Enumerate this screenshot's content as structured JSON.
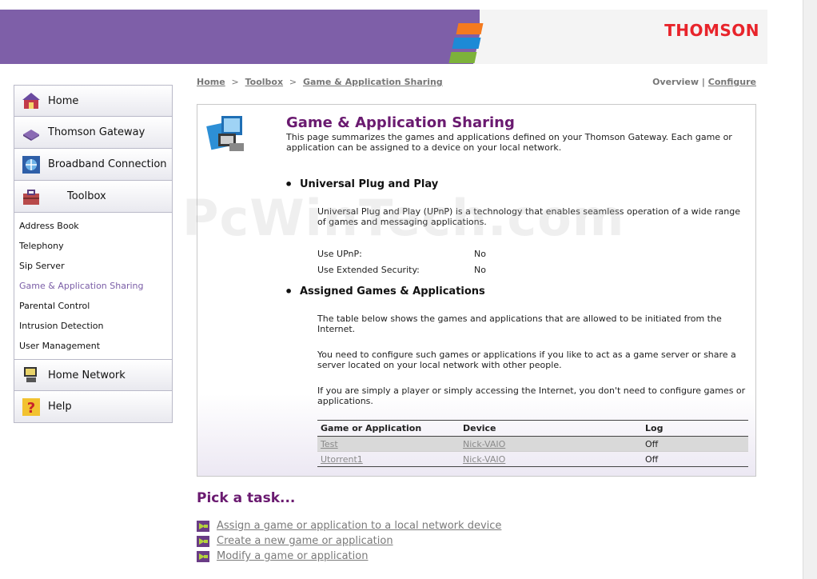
{
  "header": {
    "brand": "THOMSON"
  },
  "sidebar": {
    "home": "Home",
    "gateway": "Thomson Gateway",
    "broadband": "Broadband Connection",
    "toolbox": "Toolbox",
    "toolbox_items": [
      "Address Book",
      "Telephony",
      "Sip Server",
      "Game & Application Sharing",
      "Parental Control",
      "Intrusion Detection",
      "User Management"
    ],
    "home_network": "Home Network",
    "help": "Help"
  },
  "breadcrumb": {
    "home": "Home",
    "sep1": ">",
    "toolbox": "Toolbox",
    "sep2": ">",
    "current": "Game & Application Sharing"
  },
  "toplinks": {
    "overview": "Overview",
    "divider": "|",
    "configure": "Configure"
  },
  "page": {
    "title": "Game & Application Sharing",
    "description": "This page summarizes the games and applications defined on your Thomson Gateway. Each game or application can be assigned to a device on your local network.",
    "upnp": {
      "heading": "Universal Plug and Play",
      "text": "Universal Plug and Play (UPnP) is a technology that enables seamless operation of a wide range of games and messaging applications.",
      "use_upnp_label": "Use UPnP:",
      "use_upnp_value": "No",
      "ext_sec_label": "Use Extended Security:",
      "ext_sec_value": "No"
    },
    "assigned": {
      "heading": "Assigned Games & Applications",
      "p1": "The table below shows the games and applications that are allowed to be initiated from the Internet.",
      "p2": "You need to configure such games or applications if you like to act as a game server or share a server located on your local network with other people.",
      "p3": "If you are simply a player or simply accessing the Internet, you don't need to configure games or applications."
    },
    "table": {
      "headers": [
        "Game or Application",
        "Device",
        "Log"
      ],
      "rows": [
        {
          "app": "Test",
          "device": "Nick-VAIO",
          "log": "Off"
        },
        {
          "app": "Utorrent1",
          "device": "Nick-VAIO",
          "log": "Off"
        }
      ]
    }
  },
  "tasks": {
    "title": "Pick a task...",
    "items": [
      "Assign a game or application to a local network device",
      "Create a new game or application",
      "Modify a game or application"
    ]
  },
  "watermark": "PcWinTech.com",
  "colors": {
    "banner": "#7e5fa8",
    "title": "#6a1a70",
    "brand": "#e8242b"
  }
}
